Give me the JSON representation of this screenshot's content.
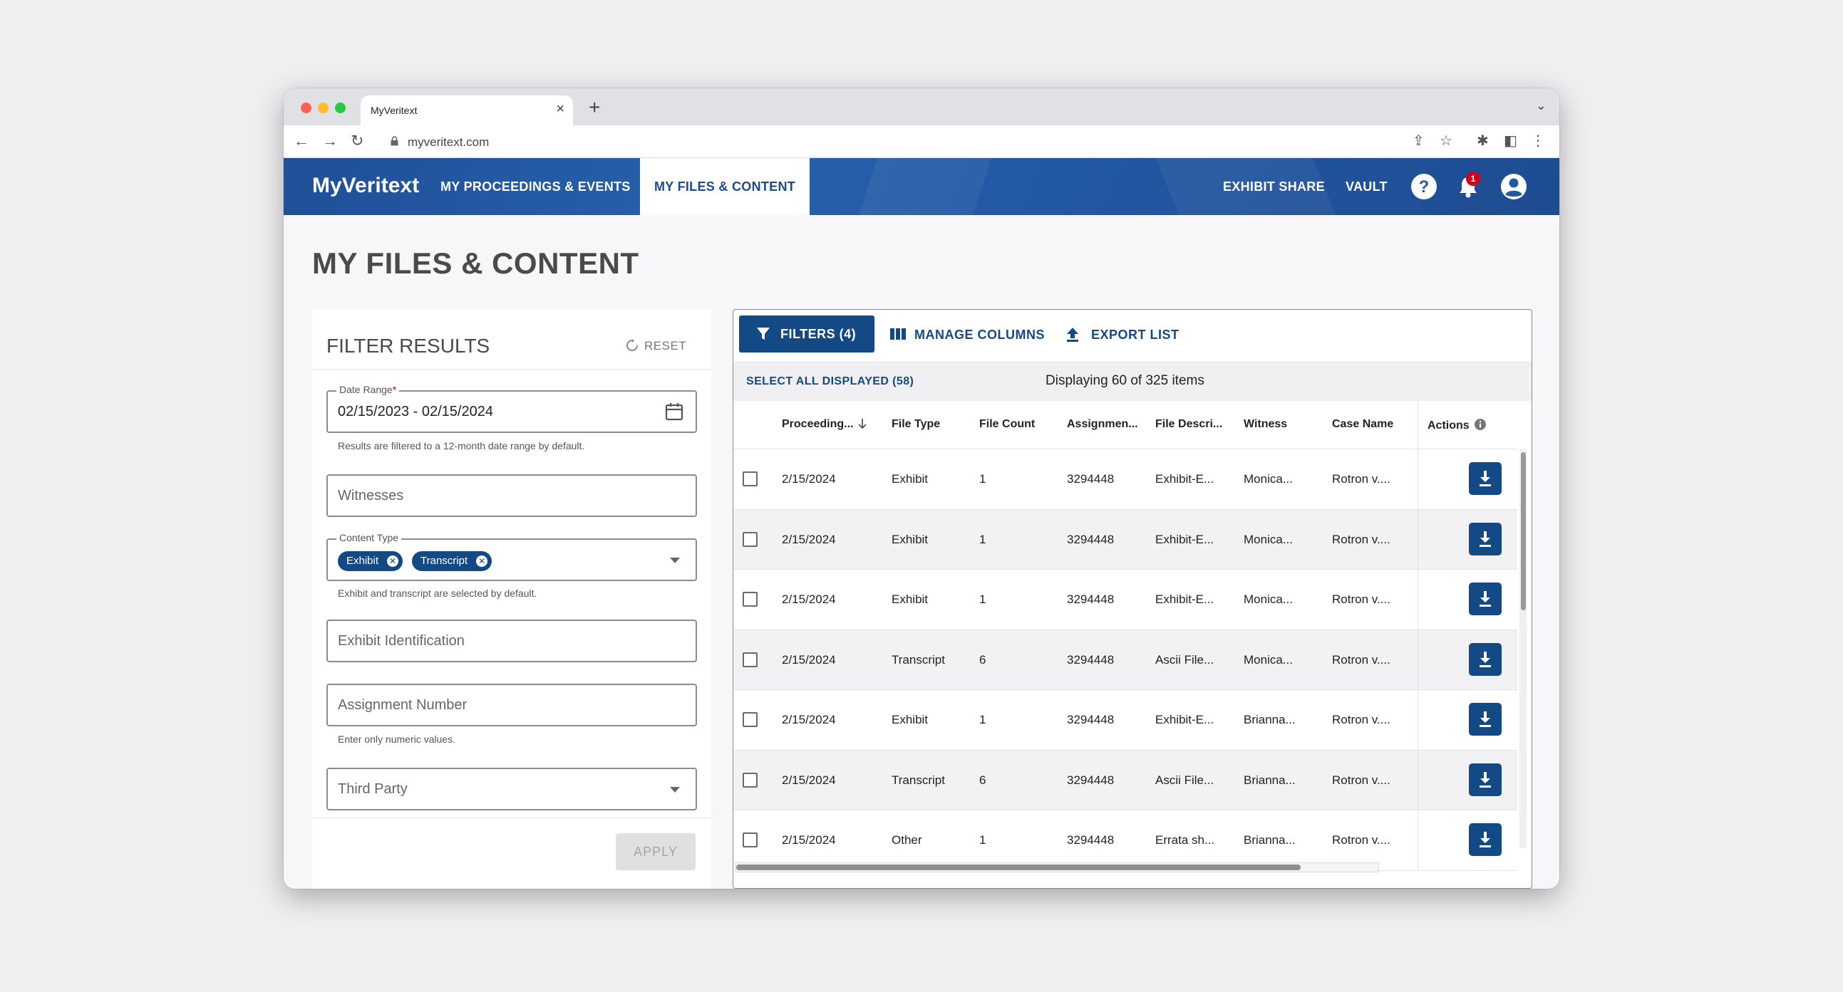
{
  "browser": {
    "tab_title": "MyVeritext",
    "tab_close": "×",
    "new_tab": "+",
    "url": "myveritext.com",
    "traffic_colors": [
      "#ff5f57",
      "#febc2e",
      "#28c840"
    ]
  },
  "header": {
    "brand": "MyVeritext",
    "nav": [
      "MY PROCEEDINGS & EVENTS",
      "MY FILES & CONTENT"
    ],
    "active_nav": "MY FILES & CONTENT",
    "right_links": [
      "EXHIBIT SHARE",
      "VAULT"
    ],
    "notification_count": "1",
    "icons": [
      "help-icon",
      "bell-icon",
      "account-icon"
    ],
    "accent": "#134a85",
    "bar_color": "#2358a3"
  },
  "page": {
    "title": "MY FILES & CONTENT"
  },
  "filters": {
    "title": "FILTER RESULTS",
    "reset_label": "RESET",
    "date_range": {
      "label": "Date Range",
      "required_mark": "*",
      "value": "02/15/2023 - 02/15/2024",
      "help": "Results are filtered to a 12-month date range by default."
    },
    "witnesses": {
      "placeholder": "Witnesses"
    },
    "content_type": {
      "label": "Content Type",
      "chips": [
        "Exhibit",
        "Transcript"
      ],
      "help": "Exhibit and transcript are selected by default."
    },
    "exhibit_identification": {
      "placeholder": "Exhibit Identification"
    },
    "assignment_number": {
      "placeholder": "Assignment Number",
      "help": "Enter only numeric values."
    },
    "third_party": {
      "placeholder": "Third Party"
    },
    "apply_label": "APPLY"
  },
  "results": {
    "filters_button": "FILTERS (4)",
    "manage_columns": "MANAGE COLUMNS",
    "export_list": "EXPORT LIST",
    "select_all": "SELECT ALL DISPLAYED (58)",
    "displaying": "Displaying 60 of 325 items",
    "columns": [
      "Proceeding...",
      "File Type",
      "File Count",
      "Assignmen...",
      "File Descri...",
      "Witness",
      "Case Name",
      "Actions"
    ],
    "rows": [
      [
        "2/15/2024",
        "Exhibit",
        "1",
        "3294448",
        "Exhibit-E...",
        "Monica...",
        "Rotron v...."
      ],
      [
        "2/15/2024",
        "Exhibit",
        "1",
        "3294448",
        "Exhibit-E...",
        "Monica...",
        "Rotron v...."
      ],
      [
        "2/15/2024",
        "Exhibit",
        "1",
        "3294448",
        "Exhibit-E...",
        "Monica...",
        "Rotron v...."
      ],
      [
        "2/15/2024",
        "Transcript",
        "6",
        "3294448",
        "Ascii File...",
        "Monica...",
        "Rotron v...."
      ],
      [
        "2/15/2024",
        "Exhibit",
        "1",
        "3294448",
        "Exhibit-E...",
        "Brianna...",
        "Rotron v...."
      ],
      [
        "2/15/2024",
        "Transcript",
        "6",
        "3294448",
        "Ascii File...",
        "Brianna...",
        "Rotron v...."
      ],
      [
        "2/15/2024",
        "Other",
        "1",
        "3294448",
        "Errata sh...",
        "Brianna...",
        "Rotron v...."
      ]
    ]
  }
}
